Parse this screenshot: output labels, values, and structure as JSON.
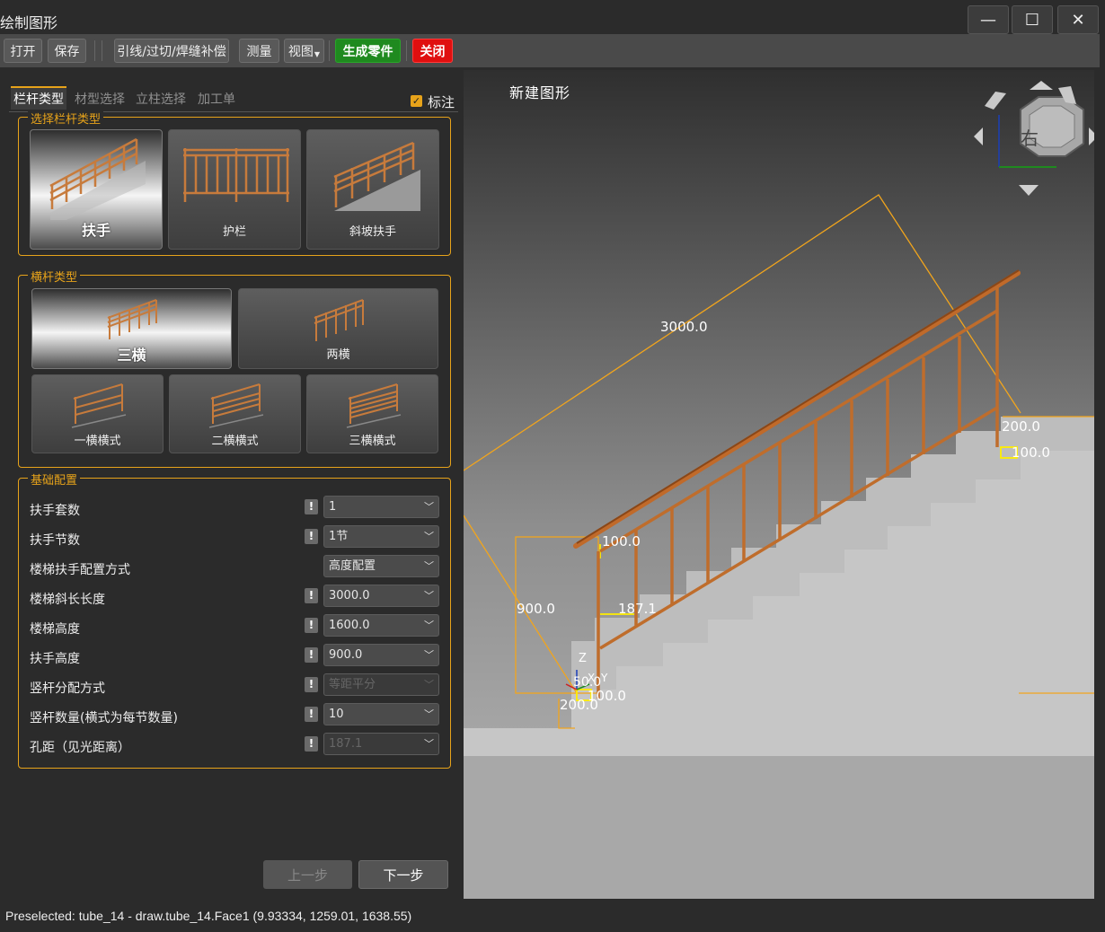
{
  "window": {
    "title": "绘制图形",
    "minimize_label": "—",
    "maximize_label": "☐",
    "close_label": "✕"
  },
  "toolbar": {
    "open": "打开",
    "save": "保存",
    "lead_cut_weld": "引线/过切/焊缝补偿",
    "measure": "测量",
    "view": "视图",
    "generate_parts": "生成零件",
    "close": "关闭"
  },
  "tabs": [
    "栏杆类型",
    "材型选择",
    "立柱选择",
    "加工单"
  ],
  "label_toggle": {
    "text": "标注",
    "checked": true
  },
  "railing_type": {
    "title": "选择栏杆类型",
    "options": [
      "扶手",
      "护栏",
      "斜坡扶手"
    ],
    "selected": "扶手"
  },
  "rail_type": {
    "title": "横杆类型",
    "options": [
      "三横",
      "两横",
      "一横横式",
      "二横横式",
      "三横横式"
    ],
    "selected": "三横"
  },
  "basic_config": {
    "title": "基础配置",
    "rows": [
      {
        "label": "扶手套数",
        "value": "1",
        "warn": "!"
      },
      {
        "label": "扶手节数",
        "value": "1节",
        "warn": "!"
      },
      {
        "label": "楼梯扶手配置方式",
        "value": "高度配置",
        "warn": ""
      },
      {
        "label": "楼梯斜长长度",
        "value": "3000.0",
        "warn": "!"
      },
      {
        "label": "楼梯高度",
        "value": "1600.0",
        "warn": "!"
      },
      {
        "label": "扶手高度",
        "value": "900.0",
        "warn": "!"
      },
      {
        "label": "竖杆分配方式",
        "value": "等距平分",
        "warn": "!"
      },
      {
        "label": "竖杆数量(横式为每节数量)",
        "value": "10",
        "warn": "!"
      },
      {
        "label": "孔距（见光距离）",
        "value": "187.1",
        "warn": "!"
      }
    ]
  },
  "nav": {
    "prev": "上一步",
    "next": "下一步"
  },
  "viewport": {
    "title": "新建图形",
    "navcube_face": "右",
    "dimensions": [
      "3000.0",
      "200.0",
      "100.0",
      "100.0",
      "900.0",
      "187.1",
      "50.0",
      "100.0",
      "200.0"
    ],
    "axis_labels": [
      "Z",
      "X",
      "Y"
    ]
  },
  "status": "Preselected: tube_14 - draw.tube_14.Face1 (9.93334, 1259.01, 1638.55)"
}
